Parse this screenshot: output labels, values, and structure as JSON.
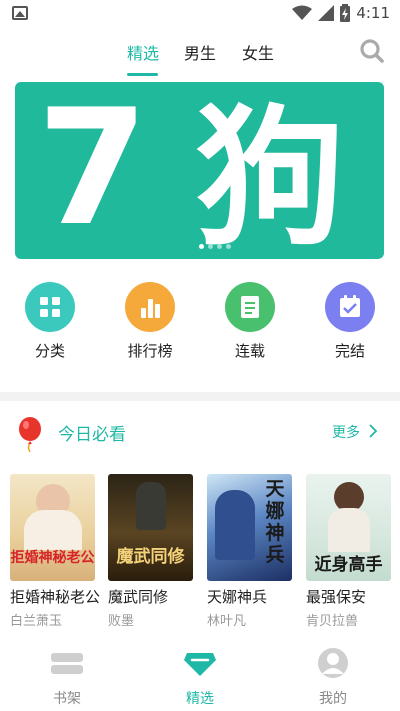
{
  "status_bar": {
    "time": "4:11"
  },
  "top_tabs": {
    "items": [
      "精选",
      "男生",
      "女生"
    ],
    "active_index": 0
  },
  "banner": {
    "text_large": "7",
    "text_char": "狗",
    "dot_count": 4,
    "active_dot": 0,
    "color": "#20b99b"
  },
  "categories": [
    {
      "label": "分类",
      "icon": "grid-icon",
      "color": "#3cc9bd"
    },
    {
      "label": "排行榜",
      "icon": "bar-chart-icon",
      "color": "#f6a93b"
    },
    {
      "label": "连载",
      "icon": "document-icon",
      "color": "#49c06d"
    },
    {
      "label": "完结",
      "icon": "calendar-check-icon",
      "color": "#7b7ff0"
    }
  ],
  "section": {
    "title": "今日必看",
    "more": "更多"
  },
  "books": [
    {
      "title": "拒婚神秘老公",
      "author": "白兰萧玉",
      "cover_text": "拒婚神秘老公"
    },
    {
      "title": "魔武同修",
      "author": "败墨",
      "cover_text": "魔武同修"
    },
    {
      "title": "天娜神兵",
      "author": "林叶凡",
      "cover_text": "天娜神兵"
    },
    {
      "title": "最强保安",
      "author": "肯贝拉兽",
      "cover_text": "近身高手"
    }
  ],
  "bottom_nav": {
    "items": [
      {
        "label": "书架",
        "icon": "bookshelf-icon"
      },
      {
        "label": "精选",
        "icon": "diamond-icon"
      },
      {
        "label": "我的",
        "icon": "user-icon"
      }
    ],
    "active_index": 1
  },
  "colors": {
    "accent": "#1fb8a6"
  }
}
